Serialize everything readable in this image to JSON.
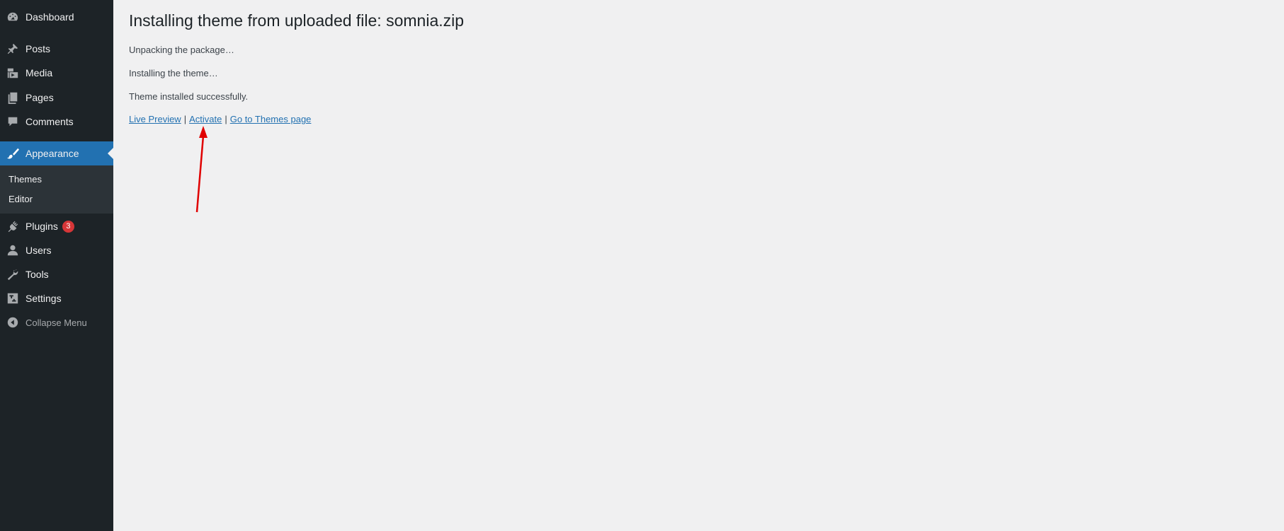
{
  "sidebar": {
    "items": [
      {
        "label": "Dashboard",
        "icon": "dashboard-icon"
      },
      {
        "label": "Posts",
        "icon": "pin-icon"
      },
      {
        "label": "Media",
        "icon": "media-icon"
      },
      {
        "label": "Pages",
        "icon": "pages-icon"
      },
      {
        "label": "Comments",
        "icon": "comment-icon"
      },
      {
        "label": "Appearance",
        "icon": "brush-icon"
      },
      {
        "label": "Plugins",
        "icon": "plugin-icon",
        "badge": "3"
      },
      {
        "label": "Users",
        "icon": "user-icon"
      },
      {
        "label": "Tools",
        "icon": "wrench-icon"
      },
      {
        "label": "Settings",
        "icon": "settings-icon"
      },
      {
        "label": "Collapse Menu",
        "icon": "collapse-icon"
      }
    ],
    "submenu": [
      "Themes",
      "Editor"
    ],
    "accent_color": "#2271b1",
    "badge_color": "#d63638"
  },
  "main": {
    "title": "Installing theme from uploaded file: somnia.zip",
    "lines": [
      "Unpacking the package…",
      "Installing the theme…",
      "Theme installed successfully."
    ],
    "links": {
      "live_preview": "Live Preview",
      "activate": "Activate",
      "themes_page": "Go to Themes page",
      "separator": "|"
    }
  },
  "annotation": {
    "arrow_color": "#e00000",
    "arrow_target": "Activate"
  }
}
